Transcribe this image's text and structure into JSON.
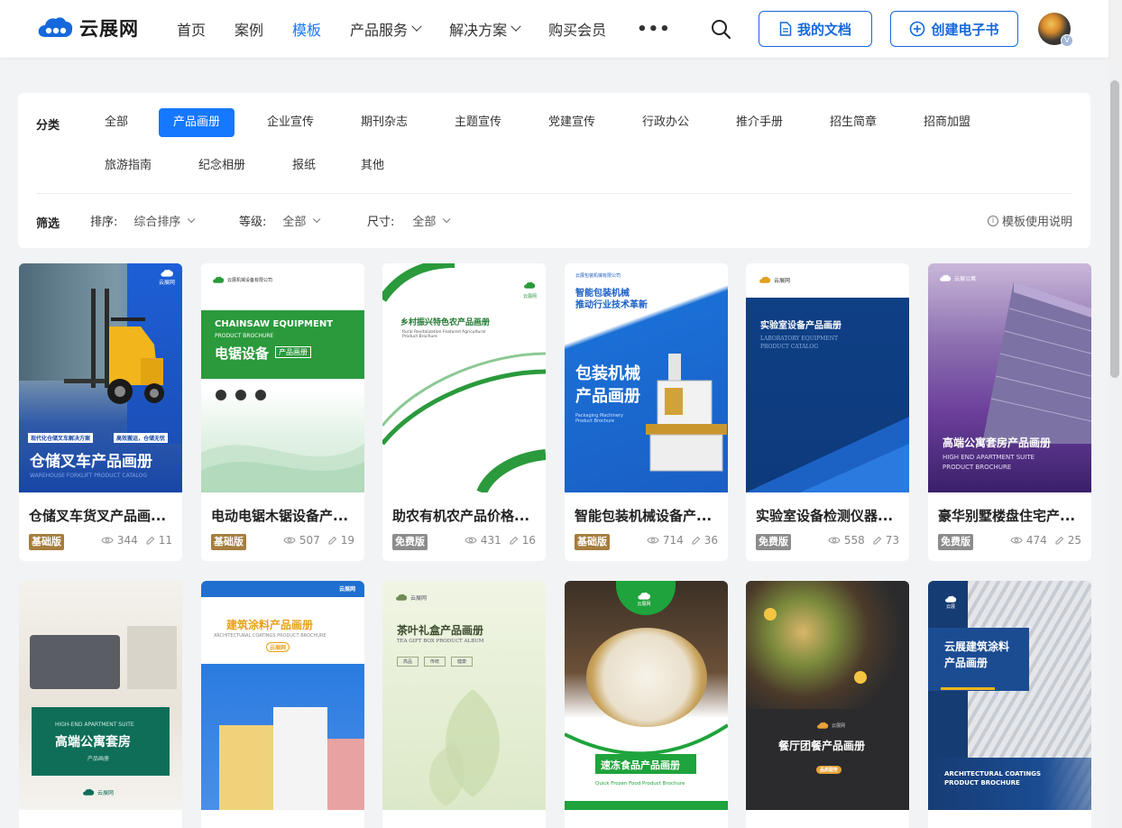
{
  "header": {
    "logo_text": "云展网",
    "nav": [
      {
        "label": "首页"
      },
      {
        "label": "案例"
      },
      {
        "label": "模板"
      },
      {
        "label": "产品服务"
      },
      {
        "label": "解决方案"
      },
      {
        "label": "购买会员"
      }
    ],
    "more_label": "•••",
    "my_docs_label": "我的文档",
    "create_ebook_label": "创建电子书",
    "avatar_badge": "V"
  },
  "filter": {
    "category_label": "分类",
    "categories": [
      {
        "label": "全部"
      },
      {
        "label": "产品画册"
      },
      {
        "label": "企业宣传"
      },
      {
        "label": "期刊杂志"
      },
      {
        "label": "主题宣传"
      },
      {
        "label": "党建宣传"
      },
      {
        "label": "行政办公"
      },
      {
        "label": "推介手册"
      },
      {
        "label": "招生简章"
      },
      {
        "label": "招商加盟"
      },
      {
        "label": "旅游指南"
      },
      {
        "label": "纪念相册"
      },
      {
        "label": "报纸"
      },
      {
        "label": "其他"
      }
    ],
    "active_category": "产品画册",
    "screen_label": "筛选",
    "sort_label": "排序:",
    "sort_value": "综合排序",
    "level_label": "等级:",
    "level_value": "全部",
    "size_label": "尺寸:",
    "size_value": "全部",
    "help_label": "模板使用说明"
  },
  "cards": [
    {
      "title": "仓储叉车货叉产品画...",
      "tier": "基础版",
      "tier_type": "basic",
      "views": "344",
      "edits": "11",
      "thumb": {
        "title": "仓储叉车产品画册",
        "sub": "WAREHOUSE FORKLIFT PRODUCT CATALOG",
        "tag1": "现代化仓储叉车解决方案",
        "tag2": "高效搬运，仓储无忧",
        "logo": "云展网"
      }
    },
    {
      "title": "电动电锯木锯设备产...",
      "tier": "基础版",
      "tier_type": "basic",
      "views": "507",
      "edits": "19",
      "thumb": {
        "company": "云展机械设备有限公司",
        "en": "CHAINSAW EQUIPMENT",
        "en2": "PRODUCT BROCHURE",
        "title": "电锯设备",
        "tag": "产品画册"
      }
    },
    {
      "title": "助农有机农产品价格...",
      "tier": "免费版",
      "tier_type": "free",
      "views": "431",
      "edits": "16",
      "thumb": {
        "title": "乡村振兴特色农产品画册",
        "sub": "Rural Revitalization Featured Agricultural Product Brochure",
        "logo": "云展网"
      }
    },
    {
      "title": "智能包装机械设备产...",
      "tier": "基础版",
      "tier_type": "basic",
      "views": "714",
      "edits": "36",
      "thumb": {
        "company": "云展包装机械有限公司",
        "head1": "智能包装机械",
        "head2": "推动行业技术革新",
        "title1": "包装机械",
        "title2": "产品画册",
        "sub": "Packaging Machinery Product Brochure"
      }
    },
    {
      "title": "实验室设备检测仪器...",
      "tier": "免费版",
      "tier_type": "free",
      "views": "558",
      "edits": "73",
      "thumb": {
        "logo": "云展网",
        "title": "实验室设备产品画册",
        "sub1": "LABORATORY EQUIPMENT",
        "sub2": "PRODUCT CATALOG"
      }
    },
    {
      "title": "豪华别墅楼盘住宅产...",
      "tier": "免费版",
      "tier_type": "free",
      "views": "474",
      "edits": "25",
      "thumb": {
        "logo": "云展公寓",
        "title": "高端公寓套房产品画册",
        "sub1": "HIGH END APARTMENT SUITE",
        "sub2": "PRODUCT BROCHURE"
      }
    },
    {
      "title": "",
      "tier": "",
      "tier_type": "",
      "views": "",
      "edits": "",
      "thumb": {
        "en": "HIGH-END APARTMENT SUITE",
        "title": "高端公寓套房",
        "tag": "产品画册",
        "logo": "云展网"
      }
    },
    {
      "title": "",
      "tier": "",
      "tier_type": "",
      "views": "",
      "edits": "",
      "thumb": {
        "logo": "云展网",
        "title": "建筑涂料产品画册",
        "sub": "ARCHITECTURAL COATINGS PRODUCT BROCHURE",
        "tag": "云展网"
      }
    },
    {
      "title": "",
      "tier": "",
      "tier_type": "",
      "views": "",
      "edits": "",
      "thumb": {
        "logo": "云展网",
        "title": "茶叶礼盒产品画册",
        "sub": "TEA GIFT BOX PRODUCT ALBUM",
        "tags": [
          "高品",
          "传统",
          "健康"
        ]
      }
    },
    {
      "title": "",
      "tier": "",
      "tier_type": "",
      "views": "",
      "edits": "",
      "thumb": {
        "logo": "云展网",
        "title": "速冻食品产品画册",
        "sub": "Quick Frozen Food Product Brochure"
      }
    },
    {
      "title": "",
      "tier": "",
      "tier_type": "",
      "views": "",
      "edits": "",
      "thumb": {
        "logo": "云展网",
        "title": "餐厅团餐产品画册",
        "tag": "品质服务"
      }
    },
    {
      "title": "",
      "tier": "",
      "tier_type": "",
      "views": "",
      "edits": "",
      "thumb": {
        "logo": "云展",
        "title1": "云展建筑涂料",
        "title2": "产品画册",
        "en1": "ARCHITECTURAL COATINGS",
        "en2": "PRODUCT BROCHURE"
      }
    }
  ],
  "colors": {
    "accent": "#1677ff",
    "basic_tier": "#a57d3e",
    "free_tier": "#8c8c8c"
  }
}
